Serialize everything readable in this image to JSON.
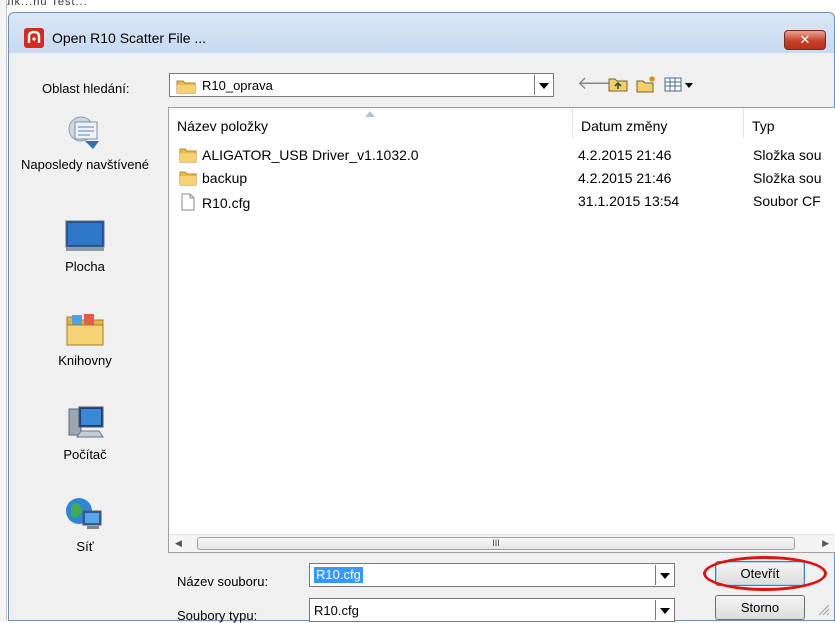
{
  "background": {
    "top_text": "ulk...nu  Test...",
    "accent": "#dce9f7"
  },
  "dialog": {
    "title": "Open R10 Scatter File ...",
    "close_label": "✕",
    "look_in_label": "Oblast hledání:",
    "look_in_value": "R10_oprava",
    "places": [
      {
        "label": "Naposledy navštívené",
        "icon": "recent-places-icon"
      },
      {
        "label": "Plocha",
        "icon": "desktop-icon"
      },
      {
        "label": "Knihovny",
        "icon": "libraries-icon"
      },
      {
        "label": "Počítač",
        "icon": "computer-icon"
      },
      {
        "label": "Síť",
        "icon": "network-icon"
      }
    ],
    "columns": {
      "name": "Název položky",
      "date": "Datum změny",
      "type": "Typ"
    },
    "files": [
      {
        "name": "ALIGATOR_USB Driver_v1.1032.0",
        "date": "4.2.2015 21:46",
        "type": "Složka sou",
        "icon": "folder-icon"
      },
      {
        "name": "backup",
        "date": "4.2.2015 21:46",
        "type": "Složka sou",
        "icon": "folder-icon"
      },
      {
        "name": "R10.cfg",
        "date": "31.1.2015 13:54",
        "type": "Soubor CF",
        "icon": "file-icon"
      }
    ],
    "scroll_thumb_label": "III",
    "file_name_label": "Název souboru:",
    "file_name_value": "R10.cfg",
    "file_type_label": "Soubory typu:",
    "file_type_value": "R10.cfg",
    "open_button": "Otevřít",
    "cancel_button": "Storno",
    "highlight_color": "#e0120f"
  }
}
